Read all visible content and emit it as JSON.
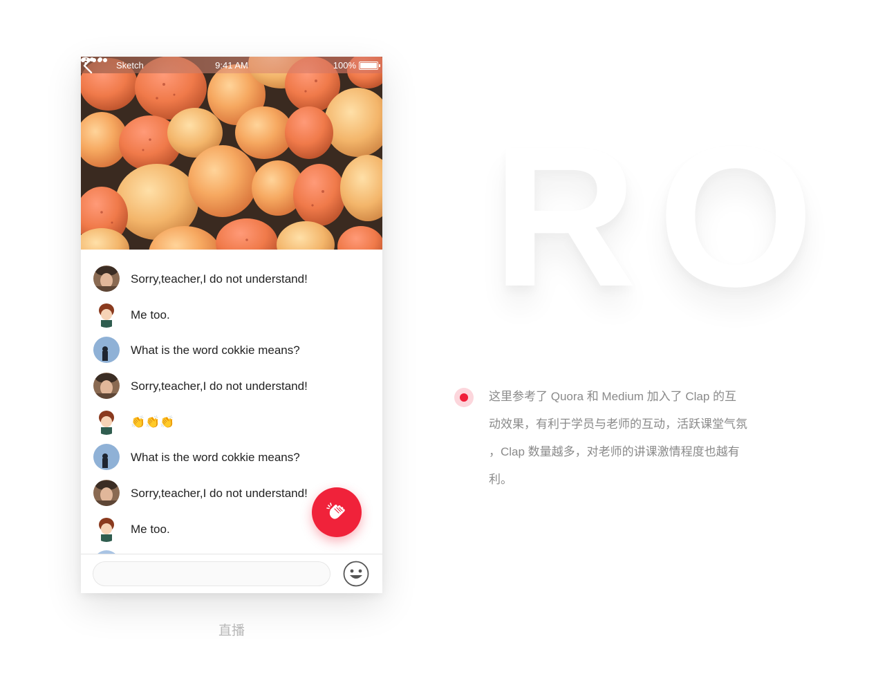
{
  "background_text": "RO",
  "status_bar": {
    "carrier": "Sketch",
    "time": "9:41 AM",
    "battery": "100%"
  },
  "header_icons": {
    "back": "chevron-left-icon",
    "more": "more-dots-icon"
  },
  "messages": [
    {
      "avatar": "avatar-photo-man-hat",
      "text": "Sorry,teacher,I do not understand!"
    },
    {
      "avatar": "avatar-cartoon-boy",
      "text": "Me too."
    },
    {
      "avatar": "avatar-blue-sky-person",
      "text": "What is the word cokkie means?"
    },
    {
      "avatar": "avatar-photo-man-hat",
      "text": "Sorry,teacher,I do not understand!"
    },
    {
      "avatar": "avatar-cartoon-boy",
      "text": "👏👏👏"
    },
    {
      "avatar": "avatar-blue-sky-person",
      "text": "What is the word cokkie means?"
    },
    {
      "avatar": "avatar-photo-man-hat",
      "text": "Sorry,teacher,I do not understand!"
    },
    {
      "avatar": "avatar-cartoon-boy",
      "text": "Me too."
    }
  ],
  "input": {
    "placeholder": ""
  },
  "icons": {
    "emoji": "emoji-face-icon",
    "clap": "clap-hands-icon"
  },
  "colors": {
    "accent": "#f0223a",
    "bullet_ring": "#fcd6dc",
    "caption": "#b7b7b7"
  },
  "caption": "直播",
  "description_lines": [
    "这里参考了 Quora 和 Medium 加入了 Clap 的互",
    "动效果，有利于学员与老师的互动，活跃课堂气氛",
    "，Clap 数量越多，对老师的讲课激情程度也越有",
    "利。"
  ]
}
